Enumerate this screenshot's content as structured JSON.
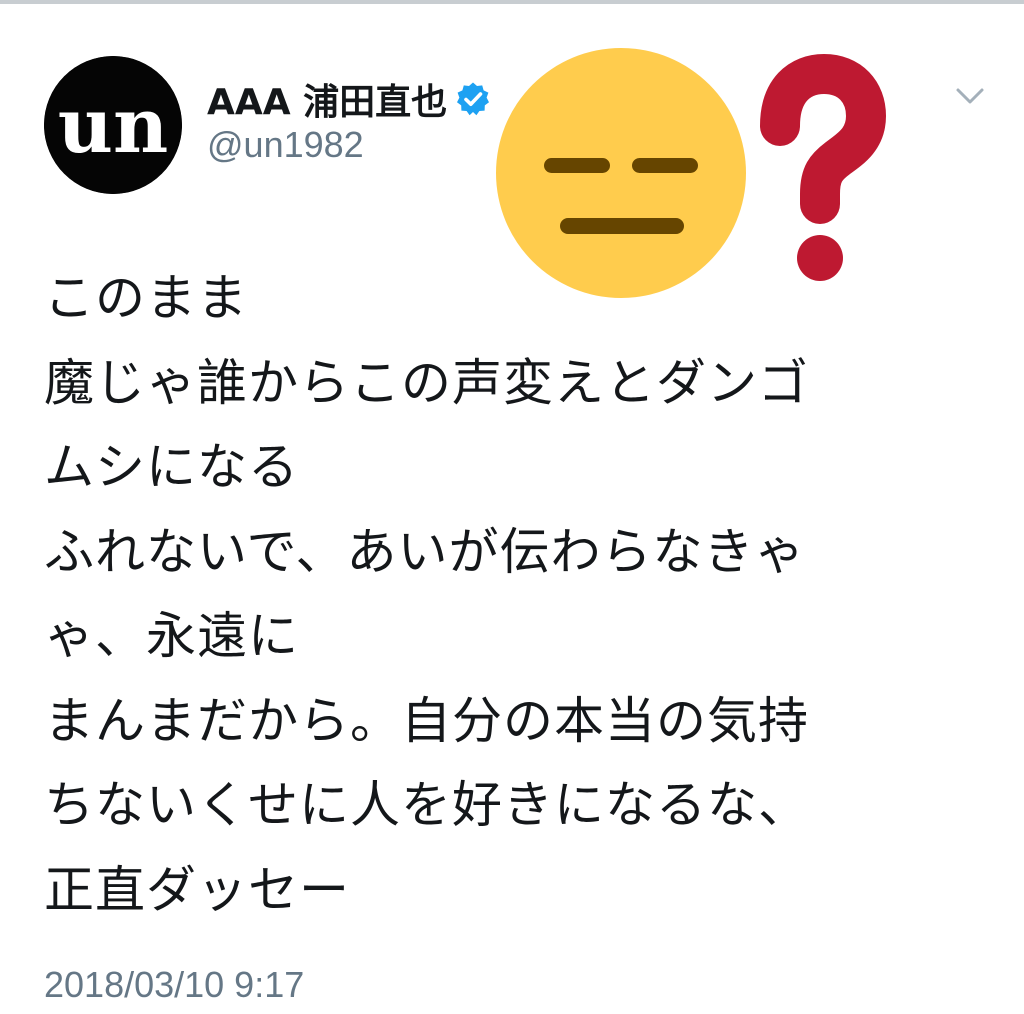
{
  "tweet": {
    "author": {
      "display_name": "AAA 浦田直也",
      "handle": "@un1982",
      "avatar_text": "un",
      "verified": true
    },
    "text_lines": [
      "このまま",
      "魔じゃ誰からこの声変えとダンゴ",
      "ムシになる",
      "ふれないで、あいが伝わらなきゃ",
      "ゃ、永遠に",
      "まんまだから。自分の本当の気持",
      "ちないくせに人を好きになるな、",
      "正直ダッセー"
    ],
    "timestamp": "2018/03/10 9:17"
  },
  "overlays": {
    "emoji": "expressionless-face-icon",
    "question": "?"
  },
  "colors": {
    "verified_blue": "#1da1f2",
    "handle_gray": "#657786",
    "emoji_yellow": "#ffcc4d",
    "emoji_features": "#664500",
    "question_red": "#be1931"
  }
}
